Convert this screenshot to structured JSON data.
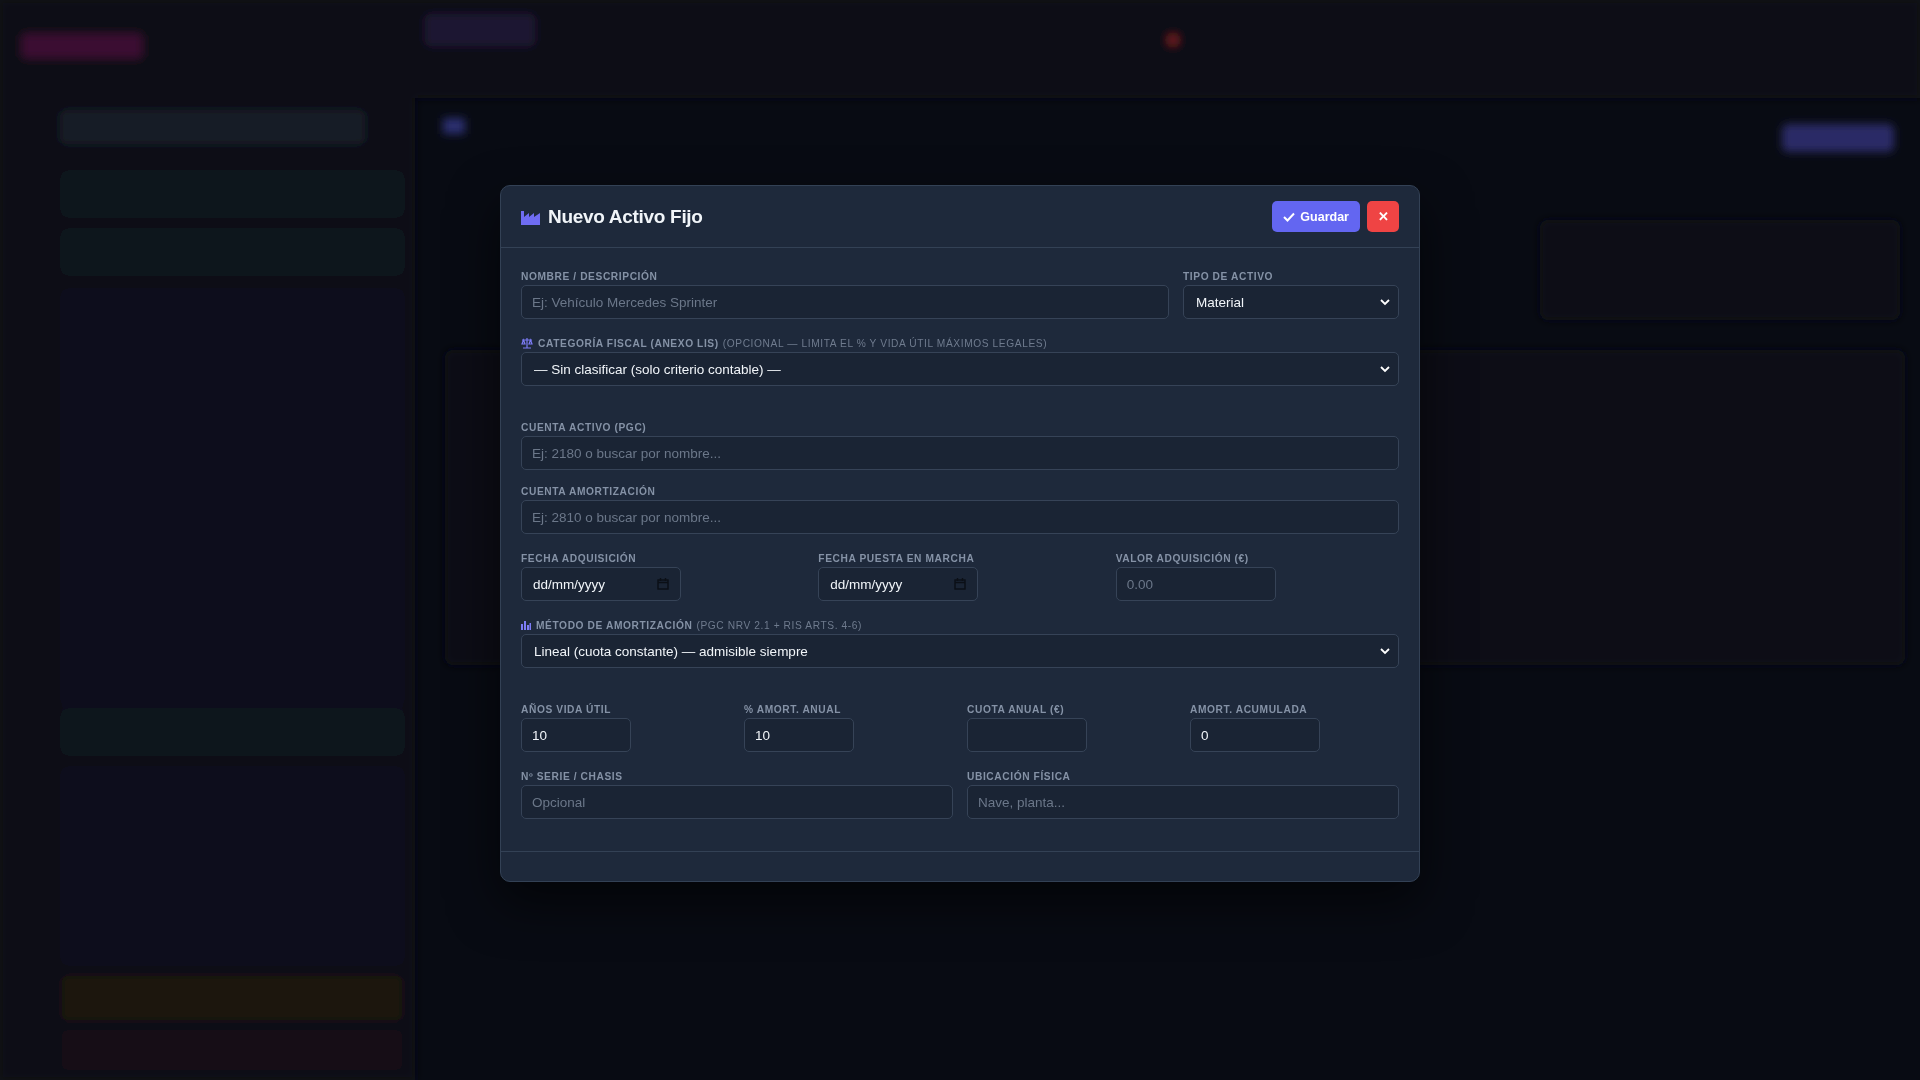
{
  "modal": {
    "title": "Nuevo Activo Fijo",
    "buttons": [
      {
        "kind": "save",
        "label": "Guardar"
      },
      {
        "kind": "close",
        "label": "✕"
      }
    ],
    "rows": [
      {
        "fields": [
          {
            "kind": "text",
            "label": "NOMBRE / DESCRIPCIÓN",
            "placeholder": "Ej: Vehículo Mercedes Sprinter"
          },
          {
            "kind": "select",
            "label": "TIPO DE ACTIVO",
            "value": "Material"
          }
        ]
      },
      {
        "fields": [
          {
            "kind": "select",
            "label": "CATEGORÍA FISCAL (ANEXO LIS)",
            "note": "(OPCIONAL — LIMITA EL % Y VIDA ÚTIL MÁXIMOS LEGALES)",
            "value": "— Sin clasificar (solo criterio contable) —"
          }
        ]
      },
      {
        "fields": [
          {
            "kind": "text",
            "label": "CUENTA ACTIVO (PGC)",
            "placeholder": "Ej: 2180 o buscar por nombre..."
          }
        ]
      },
      {
        "fields": [
          {
            "kind": "text",
            "label": "CUENTA AMORTIZACIÓN",
            "placeholder": "Ej: 2810 o buscar por nombre..."
          }
        ]
      },
      {
        "fields": [
          {
            "kind": "date",
            "label": "FECHA ADQUISICIÓN",
            "value": "dd/mm/yyyy"
          },
          {
            "kind": "date",
            "label": "FECHA PUESTA EN MARCHA",
            "value": "dd/mm/yyyy"
          },
          {
            "kind": "number",
            "label": "VALOR ADQUISICIÓN (€)",
            "placeholder": "0.00"
          }
        ]
      },
      {
        "fields": [
          {
            "kind": "select",
            "label": "MÉTODO DE AMORTIZACIÓN",
            "note": "(PGC NRV 2.1 + RIS ARTS. 4-6)",
            "value": "Lineal (cuota constante) — admisible siempre"
          }
        ]
      },
      {
        "fields": [
          {
            "kind": "number",
            "label": "AÑOS VIDA ÚTIL",
            "value": "10"
          },
          {
            "kind": "number",
            "label": "% AMORT. ANUAL",
            "value": "10"
          },
          {
            "kind": "number",
            "label": "CUOTA ANUAL (€)"
          },
          {
            "kind": "number",
            "label": "AMORT. ACUMULADA",
            "value": "0"
          }
        ]
      },
      {
        "fields": [
          {
            "kind": "text",
            "label": "Nº SERIE / CHASIS",
            "placeholder": "Opcional"
          },
          {
            "kind": "text",
            "label": "UBICACIÓN FÍSICA",
            "placeholder": "Nave, planta..."
          }
        ]
      }
    ]
  }
}
